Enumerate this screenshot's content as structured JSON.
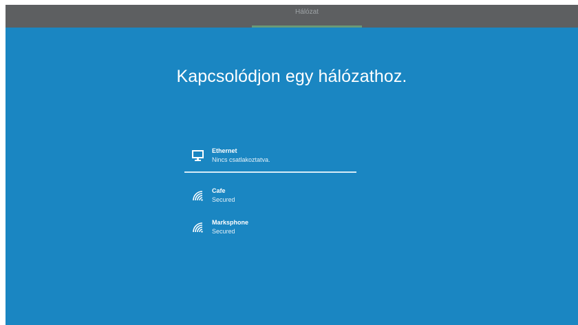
{
  "topbar": {
    "tab_label": "Hálózat"
  },
  "heading": "Kapcsolódjon egy hálózathoz.",
  "networks": [
    {
      "name": "Ethernet",
      "status": "Nincs csatlakoztatva.",
      "icon": "ethernet-monitor-icon"
    },
    {
      "name": "Cafe",
      "status": "Secured",
      "icon": "wifi-icon"
    },
    {
      "name": "Marksphone",
      "status": "Secured",
      "icon": "wifi-icon"
    }
  ],
  "colors": {
    "background": "#1a86c2",
    "topbar": "#5d5f61",
    "text": "#ffffff"
  }
}
